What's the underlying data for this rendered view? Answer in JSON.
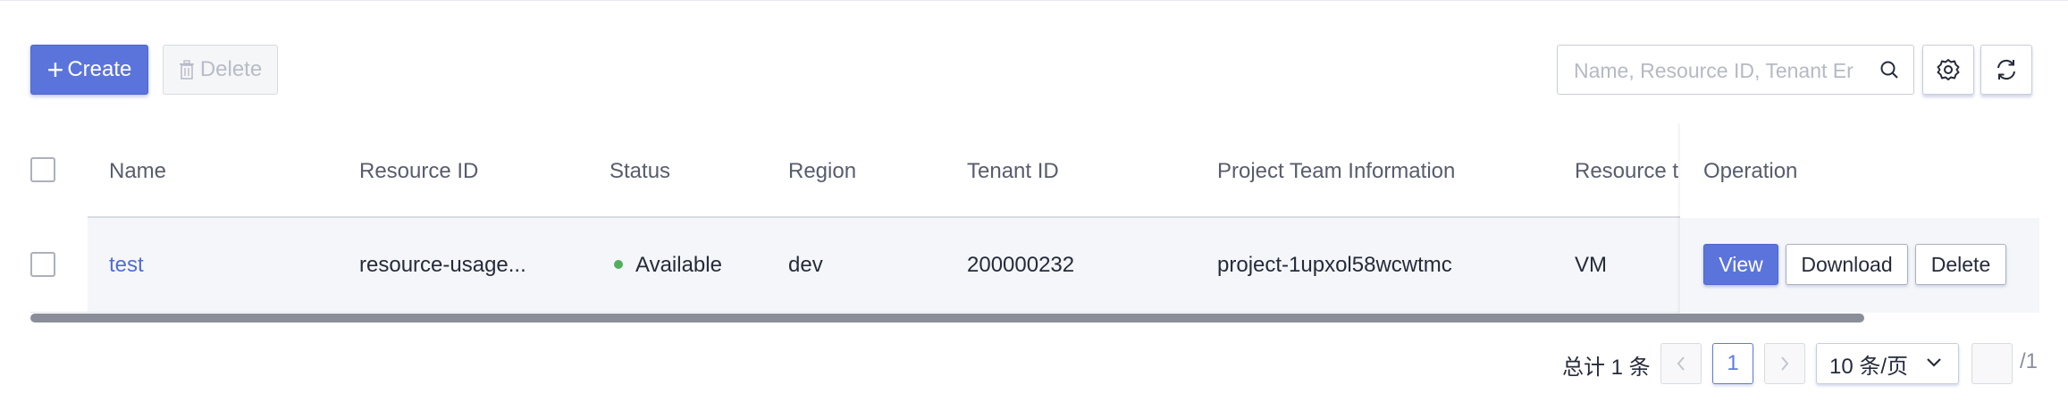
{
  "toolbar": {
    "create_label": "Create",
    "delete_label": "Delete",
    "search_placeholder": "Name, Resource ID, Tenant Er"
  },
  "table": {
    "columns": [
      "Name",
      "Resource ID",
      "Status",
      "Region",
      "Tenant ID",
      "Project Team Information",
      "Resource t",
      "Operation"
    ],
    "rows": [
      {
        "name": "test",
        "resource_id": "resource-usage...",
        "status": "Available",
        "region": "dev",
        "tenant_id": "200000232",
        "project_team": "project-1upxol58wcwtmc",
        "resource_type": "VM",
        "actions": [
          "View",
          "Download",
          "Delete"
        ]
      }
    ]
  },
  "pagination": {
    "total_text": "总计 1 条",
    "current_page": "1",
    "page_size": "10 条/页",
    "total_pages": "/1"
  },
  "colors": {
    "primary": "#5b74dc",
    "link": "#526ecc",
    "status_available": "#50b05a"
  }
}
